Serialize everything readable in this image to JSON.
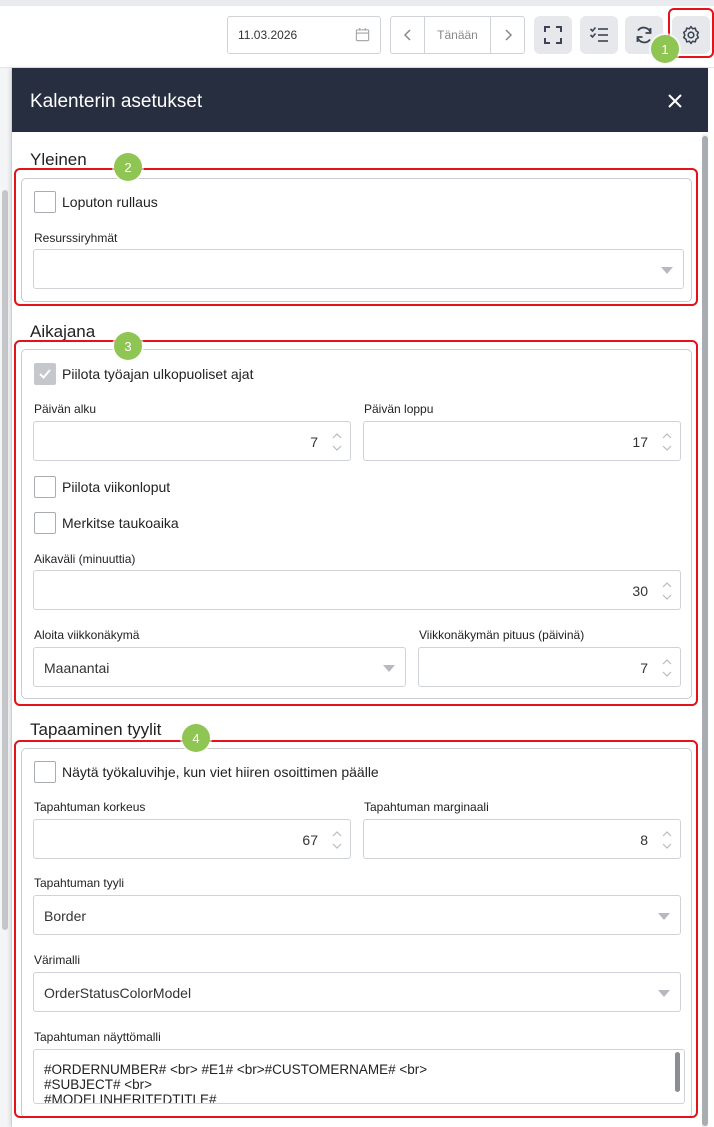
{
  "toolbar": {
    "date_value": "11.03.2026",
    "today_label": "Tänään",
    "icons": [
      "calendar-icon",
      "chevron-left-icon",
      "chevron-right-icon",
      "fullscreen-icon",
      "checklist-icon",
      "refresh-icon",
      "settings-gear-icon"
    ]
  },
  "panel": {
    "title": "Kalenterin asetukset",
    "general": {
      "title": "Yleinen",
      "infinite_scroll_label": "Loputon rullaus",
      "infinite_scroll_checked": false,
      "resource_groups_label": "Resurssiryhmät",
      "resource_groups_value": ""
    },
    "timeline": {
      "title": "Aikajana",
      "hide_offhours_label": "Piilota työajan ulkopuoliset ajat",
      "hide_offhours_checked": true,
      "day_start_label": "Päivän alku",
      "day_start_value": "7",
      "day_end_label": "Päivän loppu",
      "day_end_value": "17",
      "hide_weekends_label": "Piilota viikonloput",
      "hide_weekends_checked": false,
      "mark_breaks_label": "Merkitse taukoaika",
      "mark_breaks_checked": false,
      "interval_label": "Aikaväli (minuuttia)",
      "interval_value": "30",
      "week_start_label": "Aloita viikkonäkymä",
      "week_start_value": "Maanantai",
      "week_length_label": "Viikkonäkymän pituus (päivinä)",
      "week_length_value": "7"
    },
    "appointment_styles": {
      "title": "Tapaaminen tyylit",
      "tooltip_label": "Näytä työkaluvihje, kun viet hiiren osoittimen päälle",
      "tooltip_checked": false,
      "event_height_label": "Tapahtuman korkeus",
      "event_height_value": "67",
      "event_margin_label": "Tapahtuman marginaali",
      "event_margin_value": "8",
      "event_style_label": "Tapahtuman tyyli",
      "event_style_value": "Border",
      "color_model_label": "Värimalli",
      "color_model_value": "OrderStatusColorModel",
      "display_template_label": "Tapahtuman näyttömalli",
      "display_template_lines": [
        "#ORDERNUMBER# <br> #E1# <br>#CUSTOMERNAME# <br>",
        "#SUBJECT# <br>",
        "#MODELINHERITEDTITLE#"
      ]
    }
  },
  "annotations": {
    "badges": [
      "1",
      "2",
      "3",
      "4"
    ],
    "highlight_color": "#e3131b",
    "badge_color": "#8fc553"
  },
  "colors": {
    "header_bg": "#262e3f",
    "border": "#cfd3d8"
  }
}
